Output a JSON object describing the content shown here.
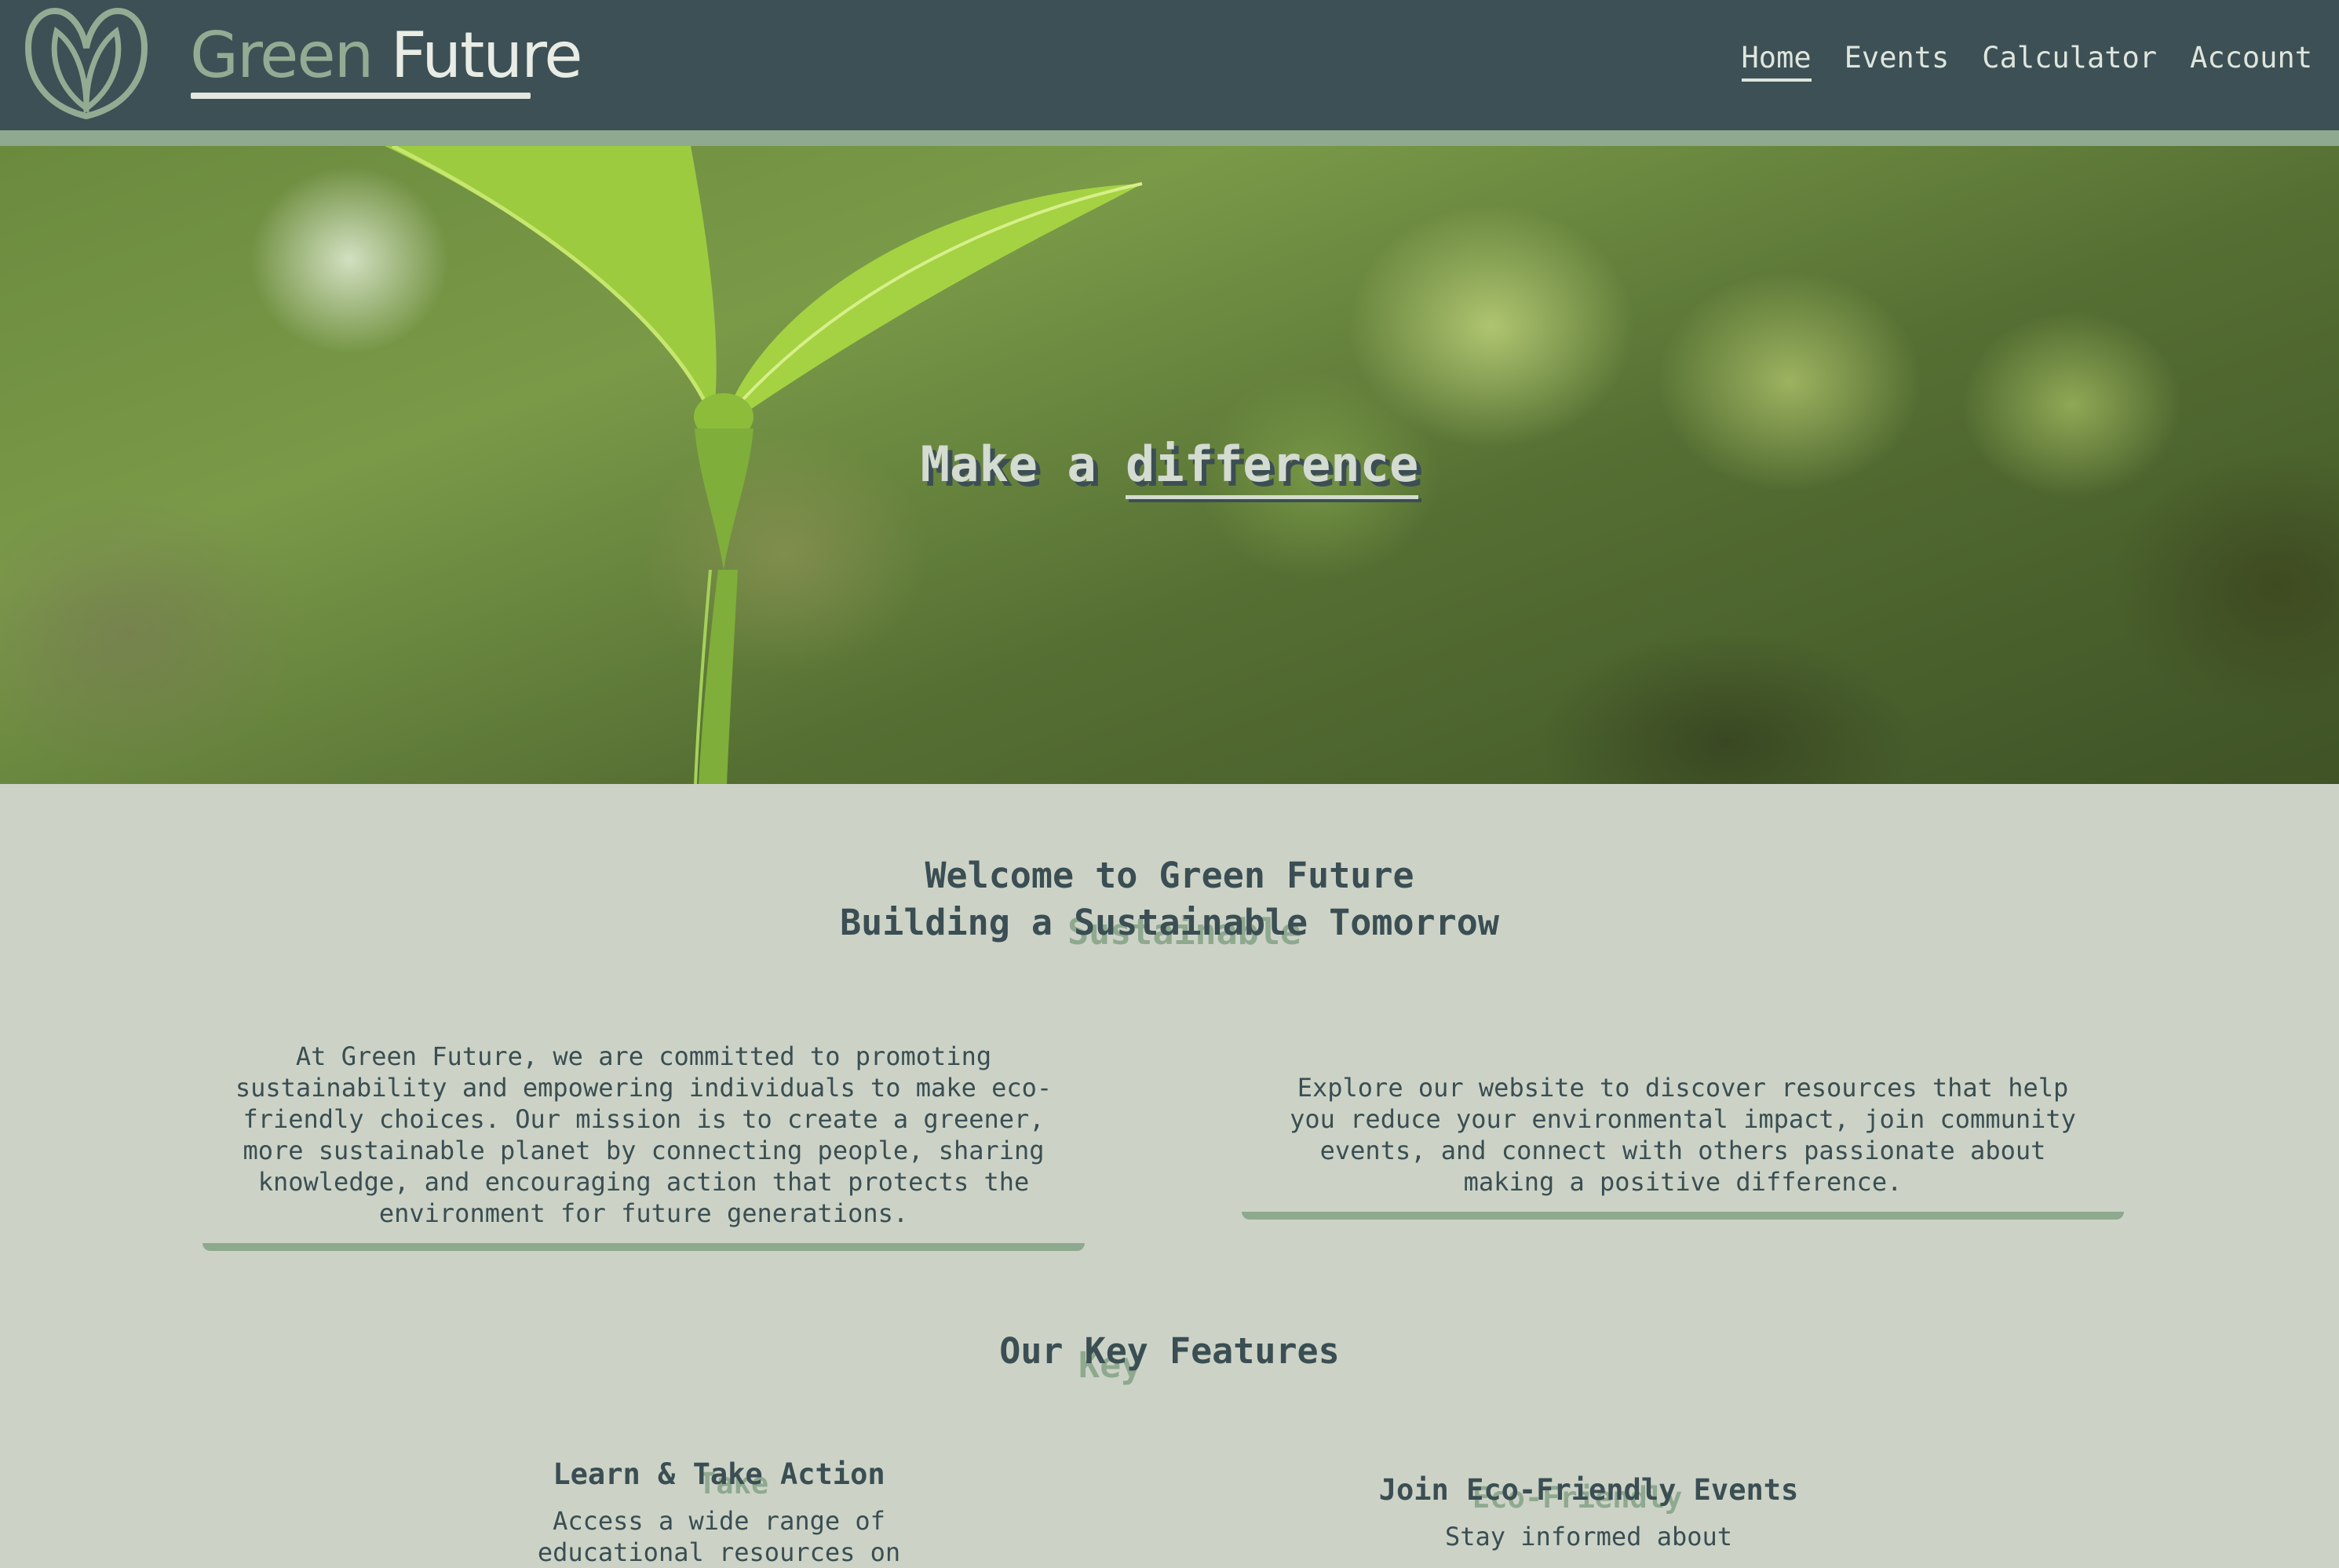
{
  "header": {
    "brand_word_1": "Green",
    "brand_word_2": "Future",
    "nav": [
      {
        "label": "Home",
        "active": true
      },
      {
        "label": "Events",
        "active": false
      },
      {
        "label": "Calculator",
        "active": false
      },
      {
        "label": "Account",
        "active": false
      }
    ]
  },
  "hero": {
    "title_part_1": "Make a ",
    "title_part_2": "difference"
  },
  "welcome": {
    "line_1": "Welcome to Green Future",
    "line_2": "Building a Sustainable Tomorrow",
    "ghost_word": "Sustainable"
  },
  "intro": {
    "card_1": "At Green Future, we are committed to promoting sustainability and empowering individuals to make eco-friendly choices. Our mission is to create a greener, more sustainable planet by connecting people, sharing knowledge, and encouraging action that protects the environment for future generations.",
    "card_2": "Explore our website to discover resources that help you reduce your environmental impact, join community events, and connect with others passionate about making a positive difference."
  },
  "features": {
    "title": "Our Key Features",
    "ghost_word": "Key",
    "items": [
      {
        "title": "Learn & Take Action",
        "ghost_word": "Take",
        "text": "Access a wide range of educational resources on"
      },
      {
        "title": "Join Eco-Friendly Events",
        "ghost_word": "Eco-Friendly",
        "text": "Stay informed about"
      }
    ]
  },
  "colors": {
    "header_bg": "#3c5055",
    "accent_green": "#8ea98f",
    "page_bg": "#ccd3c6",
    "text_dark": "#3a4e53",
    "nav_text": "#dfe5dc"
  },
  "icons": {
    "logo": "leaf-heart-icon"
  }
}
